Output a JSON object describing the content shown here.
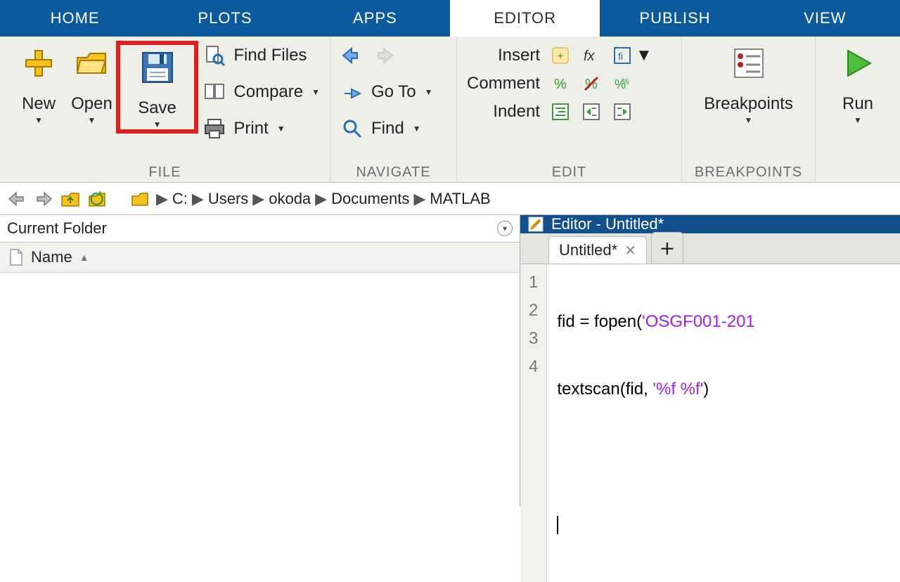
{
  "tabs": {
    "home": "HOME",
    "plots": "PLOTS",
    "apps": "APPS",
    "editor": "EDITOR",
    "publish": "PUBLISH",
    "view": "VIEW"
  },
  "ribbon": {
    "file": {
      "caption": "FILE",
      "new": "New",
      "open": "Open",
      "save": "Save",
      "findfiles": "Find Files",
      "compare": "Compare",
      "print": "Print"
    },
    "navigate": {
      "caption": "NAVIGATE",
      "goto": "Go To",
      "find": "Find"
    },
    "edit": {
      "caption": "EDIT",
      "insert": "Insert",
      "comment": "Comment",
      "indent": "Indent"
    },
    "breakpoints": {
      "caption": "BREAKPOINTS",
      "label": "Breakpoints"
    },
    "run": {
      "label": "Run"
    }
  },
  "path": {
    "segments": [
      "C:",
      "Users",
      "okoda",
      "Documents",
      "MATLAB"
    ]
  },
  "currentFolder": {
    "title": "Current Folder",
    "columnName": "Name"
  },
  "editor": {
    "panelTitle": "Editor - Untitled*",
    "tab": "Untitled*",
    "lines": [
      {
        "n": "1",
        "pre": "fid = fopen(",
        "str": "'OSGF001-201",
        "post": ""
      },
      {
        "n": "2",
        "pre": "textscan(fid, ",
        "str": "'%f %f'",
        "post": ")"
      },
      {
        "n": "3",
        "pre": "",
        "str": "",
        "post": ""
      },
      {
        "n": "4",
        "pre": "",
        "str": "",
        "post": ""
      }
    ]
  }
}
